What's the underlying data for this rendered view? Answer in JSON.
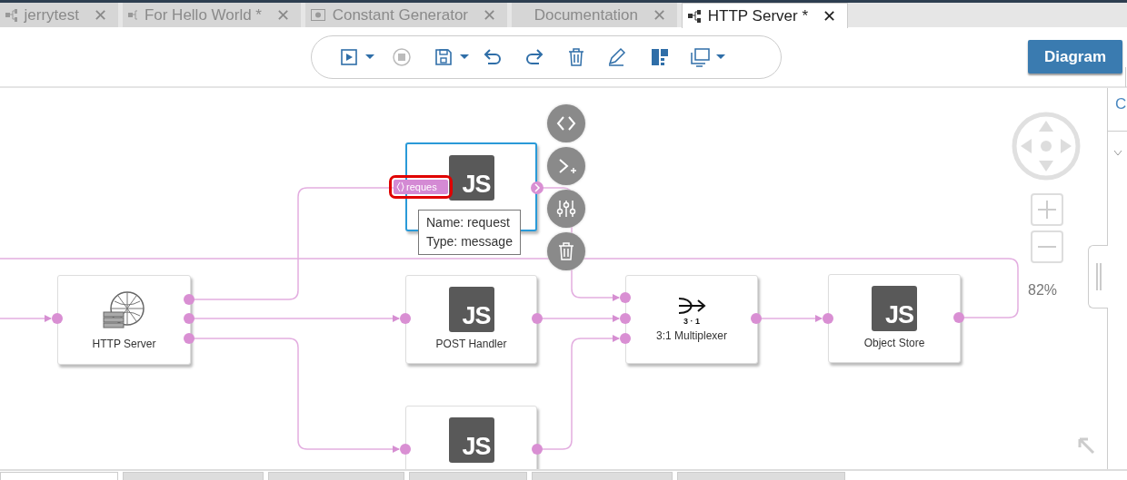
{
  "tabs": [
    {
      "label": "jerrytest",
      "kind": "flow",
      "close": "✕",
      "selected": false
    },
    {
      "label": "For Hello World *",
      "kind": "flow",
      "close": "✕",
      "selected": false
    },
    {
      "label": "Constant Generator",
      "kind": "constant",
      "close": "✕",
      "selected": false
    },
    {
      "label": "Documentation",
      "kind": "document",
      "close": "✕",
      "selected": false
    },
    {
      "label": "HTTP Server *",
      "kind": "flow",
      "close": "✕",
      "selected": true
    }
  ],
  "toolbar": [
    {
      "kind": "run"
    },
    {
      "kind": "caret"
    },
    {
      "kind": "stop"
    },
    {
      "kind": "save"
    },
    {
      "kind": "caret"
    },
    {
      "kind": "undo"
    },
    {
      "kind": "redo"
    },
    {
      "kind": "delete"
    },
    {
      "kind": "edit"
    },
    {
      "kind": "layout"
    },
    {
      "kind": "window"
    },
    {
      "kind": "caret"
    }
  ],
  "view_button": {
    "label": "Diagram",
    "selected": true
  },
  "side_panel": {
    "label": "C"
  },
  "nodes": [
    {
      "kind": "http",
      "label": "HTTP Server",
      "selected": false
    },
    {
      "kind": "js",
      "badge": "JS",
      "selected": true
    },
    {
      "kind": "js",
      "badge": "JS",
      "label": "POST Handler",
      "selected": false
    },
    {
      "kind": "mux",
      "badge": "3 · 1",
      "label": "3:1 Multiplexer",
      "selected": false
    },
    {
      "kind": "js",
      "badge": "JS",
      "label": "Object Store",
      "selected": false
    },
    {
      "kind": "js",
      "badge": "JS",
      "selected": false
    }
  ],
  "port_label": "reques",
  "tooltip": {
    "lines": [
      "Name: request",
      "Type: message"
    ]
  },
  "node_actions": [
    {
      "kind": "code"
    },
    {
      "kind": "terminal"
    },
    {
      "kind": "settings"
    },
    {
      "kind": "delete"
    }
  ],
  "zoom": "82%",
  "bottom_tabs": [
    {
      "selected": true
    },
    {
      "selected": false
    },
    {
      "selected": false
    },
    {
      "selected": false
    },
    {
      "selected": false
    },
    {
      "selected": false
    }
  ]
}
